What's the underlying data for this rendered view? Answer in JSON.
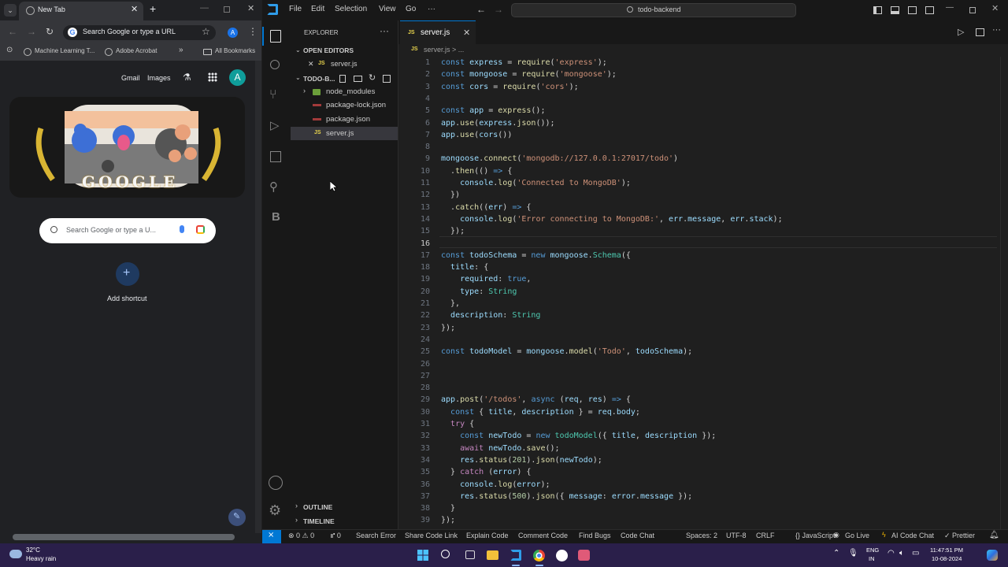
{
  "chrome": {
    "tab_title": "New Tab",
    "omnibox_text": "Search Google or type a URL",
    "profile_letter": "A",
    "bookmarks": [
      "Machine Learning T...",
      "Adobe Acrobat"
    ],
    "all_bookmarks": "All Bookmarks",
    "ntp_links": [
      "Gmail",
      "Images"
    ],
    "doodle_text": "GOOGLE",
    "search_placeholder": "Search Google or type a U...",
    "add_shortcut": "Add shortcut"
  },
  "vscode": {
    "menu": [
      "File",
      "Edit",
      "Selection",
      "View",
      "Go",
      "···"
    ],
    "command_center": "todo-backend",
    "explorer_title": "EXPLORER",
    "open_editors_label": "OPEN EDITORS",
    "open_editor_file": "server.js",
    "folder_name": "TODO-B...",
    "files": [
      {
        "name": "node_modules",
        "kind": "folder"
      },
      {
        "name": "package-lock.json",
        "kind": "json"
      },
      {
        "name": "package.json",
        "kind": "json"
      },
      {
        "name": "server.js",
        "kind": "js"
      }
    ],
    "outline_label": "OUTLINE",
    "timeline_label": "TIMELINE",
    "tab_label": "server.js",
    "breadcrumb": "server.js > ...",
    "js_badge": "JS",
    "activity_b": "B",
    "code_lines": [
      [
        [
          "k",
          "const "
        ],
        [
          "v",
          "express"
        ],
        [
          "p",
          " = "
        ],
        [
          "f",
          "require"
        ],
        [
          "p",
          "("
        ],
        [
          "s",
          "'express'"
        ],
        [
          "p",
          ");"
        ]
      ],
      [
        [
          "k",
          "const "
        ],
        [
          "v",
          "mongoose"
        ],
        [
          "p",
          " = "
        ],
        [
          "f",
          "require"
        ],
        [
          "p",
          "("
        ],
        [
          "s",
          "'mongoose'"
        ],
        [
          "p",
          ");"
        ]
      ],
      [
        [
          "k",
          "const "
        ],
        [
          "v",
          "cors"
        ],
        [
          "p",
          " = "
        ],
        [
          "f",
          "require"
        ],
        [
          "p",
          "("
        ],
        [
          "s",
          "'cors'"
        ],
        [
          "p",
          ");"
        ]
      ],
      [],
      [
        [
          "k",
          "const "
        ],
        [
          "v",
          "app"
        ],
        [
          "p",
          " = "
        ],
        [
          "f",
          "express"
        ],
        [
          "p",
          "();"
        ]
      ],
      [
        [
          "v",
          "app"
        ],
        [
          "p",
          "."
        ],
        [
          "f",
          "use"
        ],
        [
          "p",
          "("
        ],
        [
          "v",
          "express"
        ],
        [
          "p",
          "."
        ],
        [
          "f",
          "json"
        ],
        [
          "p",
          "());"
        ]
      ],
      [
        [
          "v",
          "app"
        ],
        [
          "p",
          "."
        ],
        [
          "f",
          "use"
        ],
        [
          "p",
          "("
        ],
        [
          "v",
          "cors"
        ],
        [
          "p",
          "())"
        ]
      ],
      [],
      [
        [
          "v",
          "mongoose"
        ],
        [
          "p",
          "."
        ],
        [
          "f",
          "connect"
        ],
        [
          "p",
          "("
        ],
        [
          "s",
          "'mongodb://127.0.0.1:27017/todo'"
        ],
        [
          "p",
          ")"
        ]
      ],
      [
        [
          "p",
          "  ."
        ],
        [
          "f",
          "then"
        ],
        [
          "p",
          "(() "
        ],
        [
          "k",
          "=>"
        ],
        [
          "p",
          " {"
        ]
      ],
      [
        [
          "p",
          "    "
        ],
        [
          "v",
          "console"
        ],
        [
          "p",
          "."
        ],
        [
          "f",
          "log"
        ],
        [
          "p",
          "("
        ],
        [
          "s",
          "'Connected to MongoDB'"
        ],
        [
          "p",
          ");"
        ]
      ],
      [
        [
          "p",
          "  })"
        ]
      ],
      [
        [
          "p",
          "  ."
        ],
        [
          "f",
          "catch"
        ],
        [
          "p",
          "(("
        ],
        [
          "v",
          "err"
        ],
        [
          "p",
          ") "
        ],
        [
          "k",
          "=>"
        ],
        [
          "p",
          " {"
        ]
      ],
      [
        [
          "p",
          "    "
        ],
        [
          "v",
          "console"
        ],
        [
          "p",
          "."
        ],
        [
          "f",
          "log"
        ],
        [
          "p",
          "("
        ],
        [
          "s",
          "'Error connecting to MongoDB:'"
        ],
        [
          "p",
          ", "
        ],
        [
          "v",
          "err"
        ],
        [
          "p",
          "."
        ],
        [
          "v",
          "message"
        ],
        [
          "p",
          ", "
        ],
        [
          "v",
          "err"
        ],
        [
          "p",
          "."
        ],
        [
          "v",
          "stack"
        ],
        [
          "p",
          ");"
        ]
      ],
      [
        [
          "p",
          "  });"
        ]
      ],
      [],
      [
        [
          "k",
          "const "
        ],
        [
          "v",
          "todoSchema"
        ],
        [
          "p",
          " = "
        ],
        [
          "k",
          "new "
        ],
        [
          "v",
          "mongoose"
        ],
        [
          "p",
          "."
        ],
        [
          "t",
          "Schema"
        ],
        [
          "p",
          "({"
        ]
      ],
      [
        [
          "p",
          "  "
        ],
        [
          "v",
          "title"
        ],
        [
          "p",
          ": {"
        ]
      ],
      [
        [
          "p",
          "    "
        ],
        [
          "v",
          "required"
        ],
        [
          "p",
          ": "
        ],
        [
          "k",
          "true"
        ],
        [
          "p",
          ","
        ]
      ],
      [
        [
          "p",
          "    "
        ],
        [
          "v",
          "type"
        ],
        [
          "p",
          ": "
        ],
        [
          "t",
          "String"
        ]
      ],
      [
        [
          "p",
          "  },"
        ]
      ],
      [
        [
          "p",
          "  "
        ],
        [
          "v",
          "description"
        ],
        [
          "p",
          ": "
        ],
        [
          "t",
          "String"
        ]
      ],
      [
        [
          "p",
          "});"
        ]
      ],
      [],
      [
        [
          "k",
          "const "
        ],
        [
          "v",
          "todoModel"
        ],
        [
          "p",
          " = "
        ],
        [
          "v",
          "mongoose"
        ],
        [
          "p",
          "."
        ],
        [
          "f",
          "model"
        ],
        [
          "p",
          "("
        ],
        [
          "s",
          "'Todo'"
        ],
        [
          "p",
          ", "
        ],
        [
          "v",
          "todoSchema"
        ],
        [
          "p",
          ");"
        ]
      ],
      [],
      [],
      [],
      [
        [
          "v",
          "app"
        ],
        [
          "p",
          "."
        ],
        [
          "f",
          "post"
        ],
        [
          "p",
          "("
        ],
        [
          "s",
          "'/todos'"
        ],
        [
          "p",
          ", "
        ],
        [
          "k",
          "async "
        ],
        [
          "p",
          "("
        ],
        [
          "v",
          "req"
        ],
        [
          "p",
          ", "
        ],
        [
          "v",
          "res"
        ],
        [
          "p",
          ") "
        ],
        [
          "k",
          "=>"
        ],
        [
          "p",
          " {"
        ]
      ],
      [
        [
          "p",
          "  "
        ],
        [
          "k",
          "const "
        ],
        [
          "p",
          "{ "
        ],
        [
          "v",
          "title"
        ],
        [
          "p",
          ", "
        ],
        [
          "v",
          "description"
        ],
        [
          "p",
          " } = "
        ],
        [
          "v",
          "req"
        ],
        [
          "p",
          "."
        ],
        [
          "v",
          "body"
        ],
        [
          "p",
          ";"
        ]
      ],
      [
        [
          "p",
          "  "
        ],
        [
          "kc",
          "try"
        ],
        [
          "p",
          " {"
        ]
      ],
      [
        [
          "p",
          "    "
        ],
        [
          "k",
          "const "
        ],
        [
          "v",
          "newTodo"
        ],
        [
          "p",
          " = "
        ],
        [
          "k",
          "new "
        ],
        [
          "t",
          "todoModel"
        ],
        [
          "p",
          "({ "
        ],
        [
          "v",
          "title"
        ],
        [
          "p",
          ", "
        ],
        [
          "v",
          "description"
        ],
        [
          "p",
          " });"
        ]
      ],
      [
        [
          "p",
          "    "
        ],
        [
          "kc",
          "await "
        ],
        [
          "v",
          "newTodo"
        ],
        [
          "p",
          "."
        ],
        [
          "f",
          "save"
        ],
        [
          "p",
          "();"
        ]
      ],
      [
        [
          "p",
          "    "
        ],
        [
          "v",
          "res"
        ],
        [
          "p",
          "."
        ],
        [
          "f",
          "status"
        ],
        [
          "p",
          "("
        ],
        [
          "n",
          "201"
        ],
        [
          "p",
          ")."
        ],
        [
          "f",
          "json"
        ],
        [
          "p",
          "("
        ],
        [
          "v",
          "newTodo"
        ],
        [
          "p",
          ");"
        ]
      ],
      [
        [
          "p",
          "  } "
        ],
        [
          "kc",
          "catch"
        ],
        [
          "p",
          " ("
        ],
        [
          "v",
          "error"
        ],
        [
          "p",
          ") {"
        ]
      ],
      [
        [
          "p",
          "    "
        ],
        [
          "v",
          "console"
        ],
        [
          "p",
          "."
        ],
        [
          "f",
          "log"
        ],
        [
          "p",
          "("
        ],
        [
          "v",
          "error"
        ],
        [
          "p",
          ");"
        ]
      ],
      [
        [
          "p",
          "    "
        ],
        [
          "v",
          "res"
        ],
        [
          "p",
          "."
        ],
        [
          "f",
          "status"
        ],
        [
          "p",
          "("
        ],
        [
          "n",
          "500"
        ],
        [
          "p",
          ")."
        ],
        [
          "f",
          "json"
        ],
        [
          "p",
          "({ "
        ],
        [
          "v",
          "message"
        ],
        [
          "p",
          ": "
        ],
        [
          "v",
          "error"
        ],
        [
          "p",
          "."
        ],
        [
          "v",
          "message"
        ],
        [
          "p",
          " });"
        ]
      ],
      [
        [
          "p",
          "  }"
        ]
      ],
      [
        [
          "p",
          "});"
        ]
      ]
    ],
    "status_left": [
      "⊗ 0 ⚠ 0",
      "⑈ 0",
      "Search Error",
      "Share Code Link",
      "Explain Code",
      "Comment Code",
      "Find Bugs",
      "Code Chat"
    ],
    "status_right": [
      "Spaces: 2",
      "UTF-8",
      "CRLF",
      "{} JavaScript",
      "Go Live",
      "AI Code Chat",
      "✓ Prettier"
    ]
  },
  "taskbar": {
    "temperature": "32°C",
    "weather": "Heavy rain",
    "lang": "ENG",
    "region": "IN",
    "time": "11:47:51 PM",
    "date": "10-08-2024"
  },
  "colors": {
    "vscode_blue": "#0078d4",
    "status_remote": "#0078d4",
    "taskbar": "#2a1f4a"
  }
}
